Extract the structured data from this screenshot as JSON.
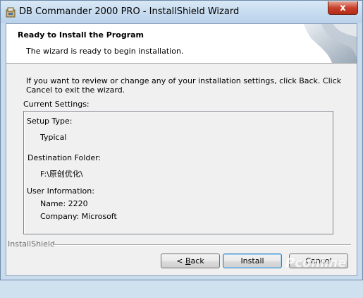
{
  "window": {
    "title": "DB Commander 2000 PRO - InstallShield Wizard",
    "close_label": "x"
  },
  "banner": {
    "title": "Ready to Install the Program",
    "subtitle": "The wizard is ready to begin installation."
  },
  "intro_text": "If you want to review or change any of your installation settings, click Back. Click Cancel to exit the wizard.",
  "current_settings": {
    "label": "Current Settings:",
    "setup_type_label": "Setup Type:",
    "setup_type_value": "Typical",
    "destination_label": "Destination Folder:",
    "destination_value": "F:\\原创优化\\",
    "user_info_label": "User Information:",
    "name_line": "Name: 2220",
    "company_line": "Company: Microsoft"
  },
  "footer": {
    "brand": "InstallShield"
  },
  "buttons": {
    "back_prefix": "< ",
    "back_accel": "B",
    "back_rest": "ack",
    "install": "Install",
    "cancel": "Cancel"
  },
  "watermark": "Pconline"
}
